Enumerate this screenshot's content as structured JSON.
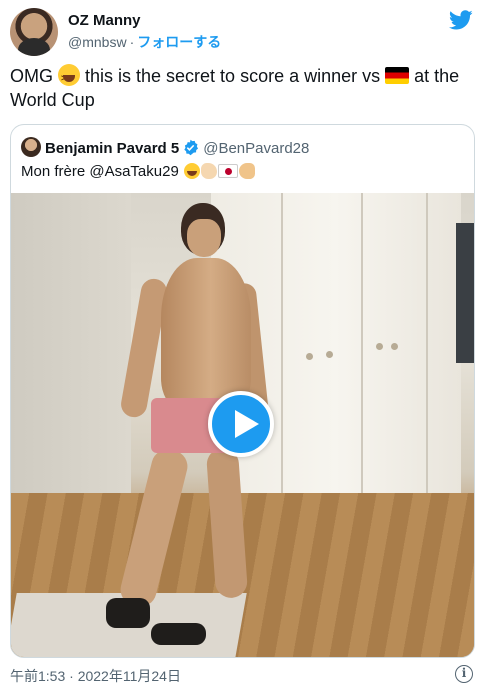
{
  "author": {
    "display_name": "OZ Manny",
    "handle": "@mnbsw",
    "separator": "·",
    "follow_label": "フォローする"
  },
  "tweet": {
    "text_before_emoji": "OMG ",
    "text_after_emoji": " this is the secret to score a winner vs ",
    "text_after_flag": " at the World Cup",
    "emojis": [
      "grinning-squinting-face",
      "germany-flag"
    ]
  },
  "quoted_tweet": {
    "display_name": "Benjamin Pavard 5",
    "handle": "@BenPavard28",
    "text": "Mon frère @AsaTaku29 ",
    "emojis": [
      "face-with-tears-of-joy",
      "clapping-hands",
      "japan-flag",
      "flexed-biceps"
    ],
    "media": {
      "type": "video",
      "play_button": "play-icon"
    }
  },
  "footer": {
    "timestamp": "午前1:53 · 2022年11月24日",
    "info_label": "i"
  },
  "colors": {
    "accent": "#1d9bf0",
    "text": "#0f1419",
    "secondary": "#536471",
    "border": "#cfd9de"
  }
}
